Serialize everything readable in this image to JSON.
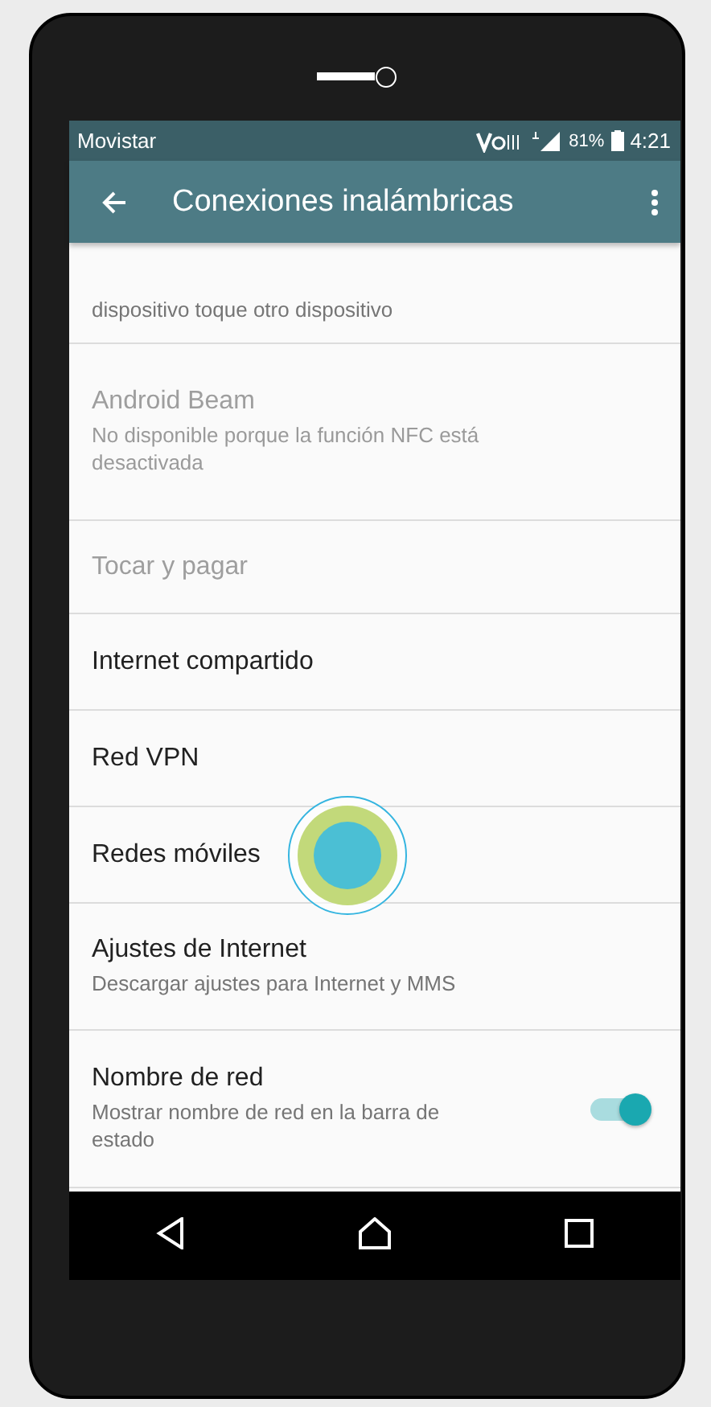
{
  "status_bar": {
    "carrier": "Movistar",
    "battery": "81%",
    "time": "4:21"
  },
  "app_bar": {
    "title": "Conexiones inalámbricas"
  },
  "settings": [
    {
      "summary": "dispositivo toque otro dispositivo",
      "disabled": false
    },
    {
      "title": "Android Beam",
      "summary": "No disponible porque la función NFC está desactivada",
      "disabled": true
    },
    {
      "title": "Tocar y pagar",
      "disabled": true
    },
    {
      "title": "Internet compartido",
      "disabled": false
    },
    {
      "title": "Red VPN",
      "disabled": false
    },
    {
      "title": "Redes móviles",
      "disabled": false
    },
    {
      "title": "Ajustes de Internet",
      "summary": "Descargar ajustes para Internet y MMS",
      "disabled": false
    },
    {
      "title": "Nombre de red",
      "summary": "Mostrar nombre de red en la barra de estado",
      "disabled": false,
      "switch_on": true
    }
  ]
}
